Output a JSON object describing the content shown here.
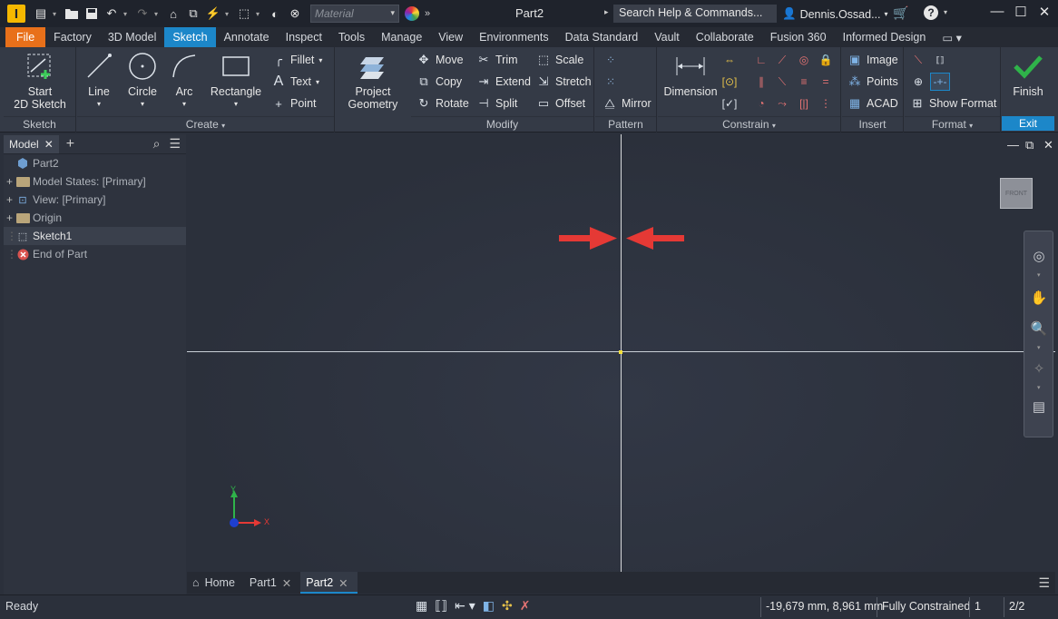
{
  "titlebar": {
    "logo": "I",
    "material_placeholder": "Material",
    "doc_title": "Part2",
    "search_placeholder": "Search Help & Commands...",
    "user": "Dennis.Ossad...",
    "icons": [
      "new-icon",
      "open-icon",
      "save-icon",
      "undo-icon",
      "redo-icon",
      "home-icon",
      "return-icon",
      "update-icon",
      "select-icon",
      "appearance-icon",
      "clear-appearance-icon",
      "color-wheel-icon",
      "more-icon",
      "cart-icon",
      "help-icon"
    ]
  },
  "tabs": {
    "file": "File",
    "items": [
      "Factory",
      "3D Model",
      "Sketch",
      "Annotate",
      "Inspect",
      "Tools",
      "Manage",
      "View",
      "Environments",
      "Data Standard",
      "Vault",
      "Collaborate",
      "Fusion 360",
      "Informed Design"
    ],
    "active": "Sketch"
  },
  "ribbon": {
    "sketch_panel": {
      "label": "Sketch",
      "start_line1": "Start",
      "start_line2": "2D Sketch"
    },
    "create_panel": {
      "label": "Create",
      "line": "Line",
      "circle": "Circle",
      "arc": "Arc",
      "rectangle": "Rectangle",
      "fillet": "Fillet",
      "text": "Text",
      "point": "Point",
      "project_line1": "Project",
      "project_line2": "Geometry"
    },
    "modify_panel": {
      "label": "Modify",
      "move": "Move",
      "copy": "Copy",
      "rotate": "Rotate",
      "trim": "Trim",
      "extend": "Extend",
      "split": "Split",
      "scale": "Scale",
      "stretch": "Stretch",
      "offset": "Offset"
    },
    "pattern_panel": {
      "label": "Pattern",
      "mirror": "Mirror"
    },
    "constrain_panel": {
      "label": "Constrain",
      "dimension": "Dimension"
    },
    "insert_panel": {
      "label": "Insert",
      "image": "Image",
      "points": "Points",
      "acad": "ACAD"
    },
    "format_panel": {
      "label": "Format",
      "show_format": "Show Format"
    },
    "exit_panel": {
      "label": "Exit",
      "finish": "Finish"
    }
  },
  "browser": {
    "tab": "Model",
    "items": [
      {
        "label": "Part2",
        "icon": "part-icon"
      },
      {
        "label": "Model States: [Primary]",
        "icon": "folder-icon"
      },
      {
        "label": "View: [Primary]",
        "icon": "view-icon"
      },
      {
        "label": "Origin",
        "icon": "folder-icon"
      },
      {
        "label": "Sketch1",
        "icon": "sketch-icon"
      },
      {
        "label": "End of Part",
        "icon": "end-of-part-icon"
      }
    ]
  },
  "canvas": {
    "viewcube_label": "FRONT",
    "axis_y": "Y",
    "axis_x": "X"
  },
  "doc_tabs": {
    "home": "Home",
    "items": [
      "Part1",
      "Part2"
    ],
    "active": "Part2"
  },
  "statusbar": {
    "ready": "Ready",
    "coordinates": "-19,679 mm, 8,961 mm",
    "constraint_status": "Fully Constrained",
    "count": "1",
    "pages": "2/2"
  },
  "colors": {
    "accent_blue": "#1c87c9",
    "file_orange": "#e8701a",
    "annotation_red": "#e53935",
    "finish_green": "#2fb34a"
  }
}
